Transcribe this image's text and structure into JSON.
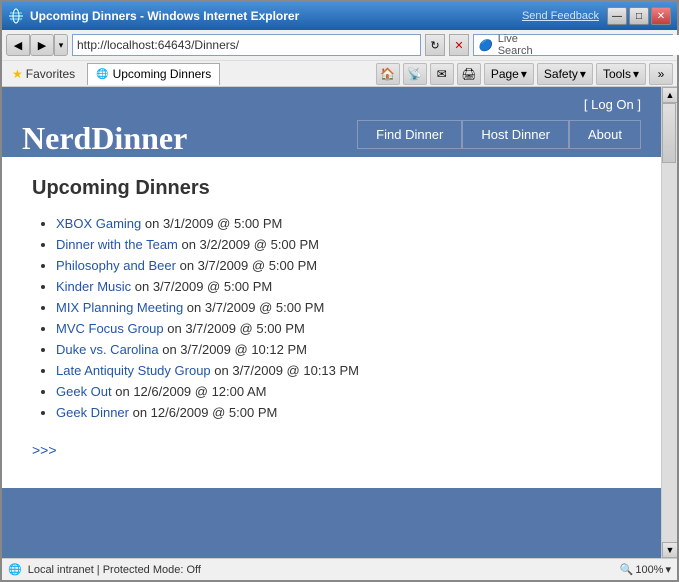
{
  "window": {
    "title": "Upcoming Dinners - Windows Internet Explorer",
    "feedback_label": "Send Feedback",
    "min_btn": "—",
    "max_btn": "□",
    "close_btn": "✕"
  },
  "address_bar": {
    "url": "http://localhost:64643/Dinners/",
    "back_arrow": "◀",
    "forward_arrow": "▶",
    "dropdown_arrow": "▾",
    "refresh": "↻",
    "stop": "✕"
  },
  "search": {
    "label": "Live Search",
    "placeholder": "",
    "icon": "🔍",
    "go_arrow": "▶"
  },
  "favorites_bar": {
    "favorites_label": "Favorites",
    "favorites_icon": "★",
    "tab_label": "Upcoming Dinners",
    "tab_icon": "🌐"
  },
  "toolbar_buttons": {
    "home": "🏠",
    "feeds": "📡",
    "read_mail": "✉",
    "print": "🖨",
    "page_label": "Page",
    "safety_label": "Safety",
    "tools_label": "Tools",
    "extra": "»",
    "dropdown": "▾"
  },
  "site": {
    "title": "NerdDinner",
    "log_on_prefix": "[ ",
    "log_on_label": "Log On",
    "log_on_suffix": " ]"
  },
  "nav": {
    "find_dinner": "Find Dinner",
    "host_dinner": "Host Dinner",
    "about": "About"
  },
  "main": {
    "heading": "Upcoming Dinners",
    "more_link": ">>>",
    "dinners": [
      {
        "title": "XBOX Gaming",
        "details": " on 3/1/2009 @ 5:00 PM"
      },
      {
        "title": "Dinner with the Team",
        "details": " on 3/2/2009 @ 5:00 PM"
      },
      {
        "title": "Philosophy and Beer",
        "details": " on 3/7/2009 @ 5:00 PM"
      },
      {
        "title": "Kinder Music",
        "details": " on 3/7/2009 @ 5:00 PM"
      },
      {
        "title": "MIX Planning Meeting",
        "details": " on 3/7/2009 @ 5:00 PM"
      },
      {
        "title": "MVC Focus Group",
        "details": " on 3/7/2009 @ 5:00 PM"
      },
      {
        "title": "Duke vs. Carolina",
        "details": " on 3/7/2009 @ 10:12 PM"
      },
      {
        "title": "Late Antiquity Study Group",
        "details": " on 3/7/2009 @ 10:13 PM"
      },
      {
        "title": "Geek Out",
        "details": " on 12/6/2009 @ 12:00 AM"
      },
      {
        "title": "Geek Dinner",
        "details": " on 12/6/2009 @ 5:00 PM"
      }
    ]
  },
  "status_bar": {
    "status": "Local intranet | Protected Mode: Off",
    "zoom": "100%",
    "zoom_icon": "🔍"
  }
}
